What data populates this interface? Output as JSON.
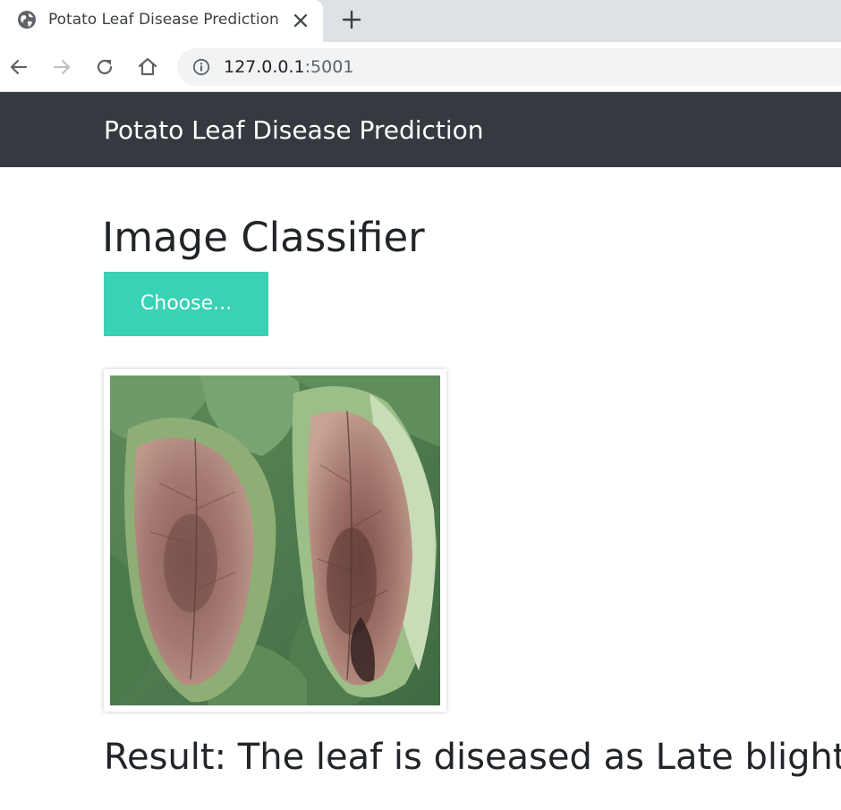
{
  "browser": {
    "tab": {
      "title": "Potato Leaf Disease Prediction",
      "favicon_icon": "globe-icon",
      "close_icon": "close-icon"
    },
    "new_tab_icon": "plus-icon",
    "nav": {
      "back_icon": "arrow-left-icon",
      "forward_icon": "arrow-right-icon",
      "reload_icon": "reload-icon",
      "home_icon": "home-icon"
    },
    "address_bar": {
      "info_icon": "info-icon",
      "host": "127.0.0.1",
      "port": ":5001"
    }
  },
  "page": {
    "navbar": {
      "brand": "Potato Leaf Disease Prediction"
    },
    "heading": "Image Classifier",
    "upload_button": {
      "label": "Choose..."
    },
    "preview_image": {
      "subject": "potato leaves with late blight lesions"
    },
    "result": "Result: The leaf is diseased as Late blight"
  },
  "colors": {
    "navbar_bg": "#343a40",
    "button_bg": "#39d2b4",
    "tabstrip_bg": "#dee1e6",
    "omnibox_bg": "#f1f3f4",
    "text": "#212529"
  }
}
